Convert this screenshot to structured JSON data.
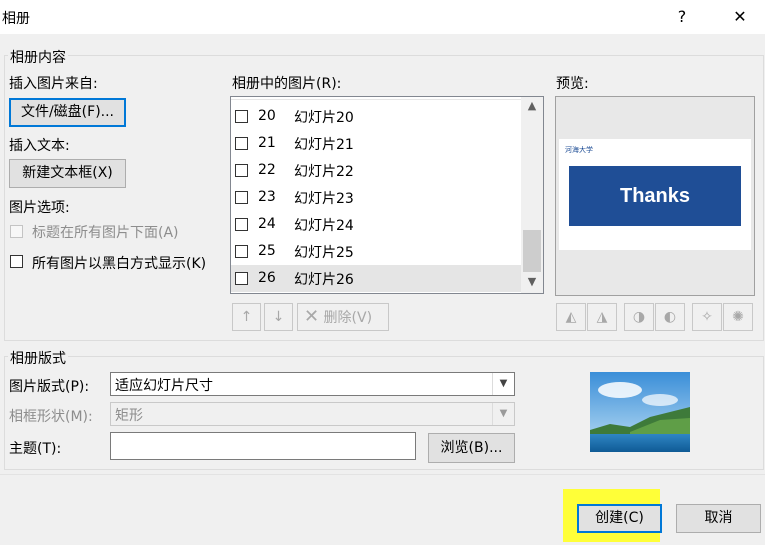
{
  "window": {
    "title": "相册",
    "help_label": "?",
    "close_label": "✕"
  },
  "content_group": {
    "legend": "相册内容",
    "insert_from_label": "插入图片来自:",
    "file_disk_button": "文件/磁盘(F)...",
    "insert_text_label": "插入文本:",
    "new_textbox_button": "新建文本框(X)",
    "picture_options_label": "图片选项:",
    "caption_option": "标题在所有图片下面(A)",
    "bw_option": "所有图片以黑白方式显示(K)",
    "pictures_label": "相册中的图片(R):",
    "pictures": [
      {
        "num": "20",
        "name": "幻灯片20",
        "selected": false
      },
      {
        "num": "21",
        "name": "幻灯片21",
        "selected": false
      },
      {
        "num": "22",
        "name": "幻灯片22",
        "selected": false
      },
      {
        "num": "23",
        "name": "幻灯片23",
        "selected": false
      },
      {
        "num": "24",
        "name": "幻灯片24",
        "selected": false
      },
      {
        "num": "25",
        "name": "幻灯片25",
        "selected": false
      },
      {
        "num": "26",
        "name": "幻灯片26",
        "selected": true
      }
    ],
    "move_up": "↑",
    "move_down": "↓",
    "delete_button": "删除(V)",
    "preview_label": "预览:",
    "preview_slide_text": "Thanks",
    "preview_logo_text": "河海大学"
  },
  "layout_group": {
    "legend": "相册版式",
    "picture_layout_label": "图片版式(P):",
    "picture_layout_value": "适应幻灯片尺寸",
    "frame_shape_label": "相框形状(M):",
    "frame_shape_value": "矩形",
    "theme_label": "主题(T):",
    "theme_value": "",
    "browse_button": "浏览(B)..."
  },
  "footer": {
    "create_button": "创建(C)",
    "cancel_button": "取消"
  },
  "colors": {
    "accent": "#0078d7",
    "slide_banner": "#1f4e96",
    "highlight": "#ffff38"
  }
}
